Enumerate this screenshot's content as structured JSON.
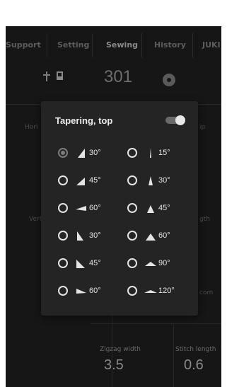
{
  "tabs": [
    "Support",
    "Setting",
    "Sewing",
    "History",
    "JUKI"
  ],
  "header": {
    "stitch_number": "301"
  },
  "side_labels": {
    "horizontal": "Hori",
    "vertical": "Vert",
    "right_top": "ip",
    "right_mid": "gth",
    "right_low": "com"
  },
  "bottom": {
    "zigzag_label": "Zigzag width",
    "zigzag_value": "3.5",
    "stitch_label": "Stitch length",
    "stitch_value": "0.6"
  },
  "modal": {
    "title": "Tapering, top",
    "toggle_on": true,
    "options_left": [
      {
        "label": "30°",
        "selected": true,
        "icon": "taper-30-right-icon"
      },
      {
        "label": "45°",
        "selected": false,
        "icon": "taper-45-right-icon"
      },
      {
        "label": "60°",
        "selected": false,
        "icon": "taper-60-right-icon"
      },
      {
        "label": "30°",
        "selected": false,
        "icon": "taper-30-left-icon"
      },
      {
        "label": "45°",
        "selected": false,
        "icon": "taper-45-left-icon"
      },
      {
        "label": "60°",
        "selected": false,
        "icon": "taper-60-left-icon"
      }
    ],
    "options_right": [
      {
        "label": "15°",
        "selected": false,
        "icon": "taper-15-center-icon"
      },
      {
        "label": "30°",
        "selected": false,
        "icon": "taper-30-center-icon"
      },
      {
        "label": "45°",
        "selected": false,
        "icon": "taper-45-center-icon"
      },
      {
        "label": "60°",
        "selected": false,
        "icon": "taper-60-center-icon"
      },
      {
        "label": "90°",
        "selected": false,
        "icon": "taper-90-center-icon"
      },
      {
        "label": "120°",
        "selected": false,
        "icon": "taper-120-center-icon"
      }
    ]
  }
}
